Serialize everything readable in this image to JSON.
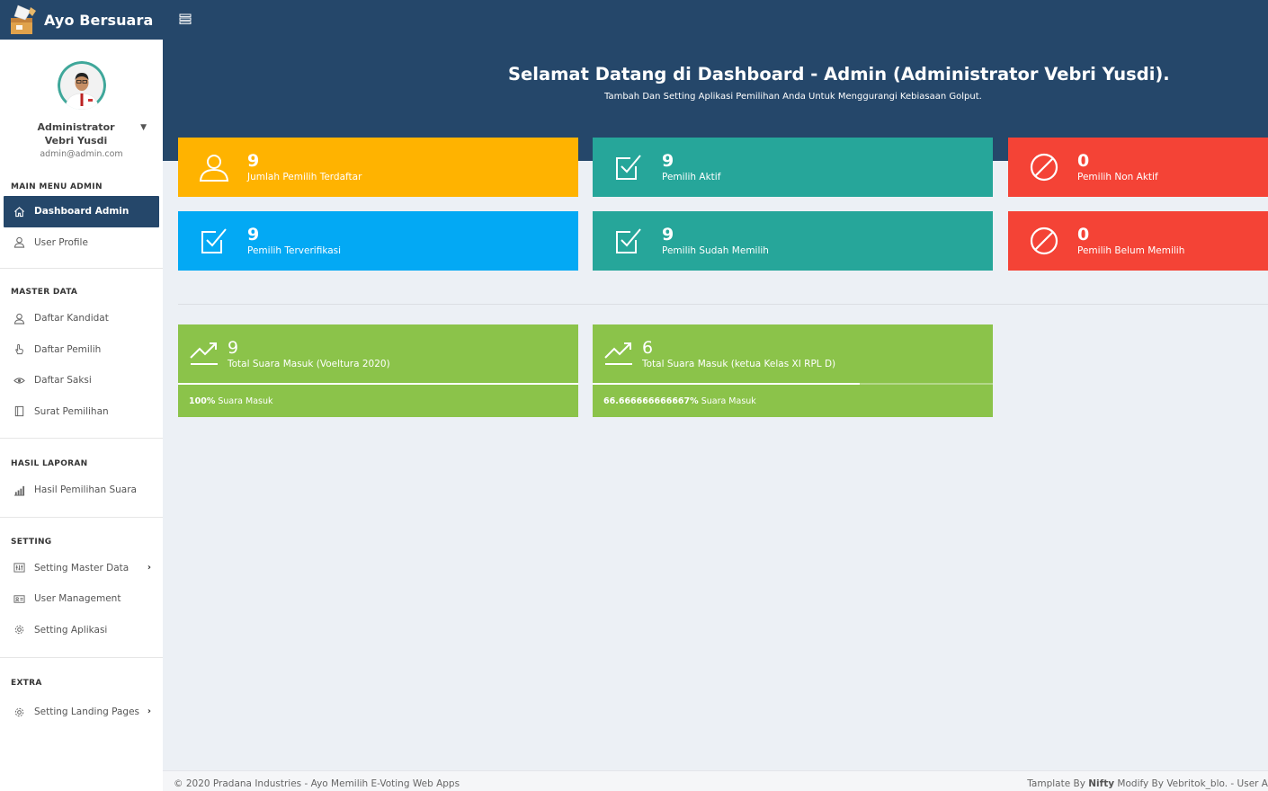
{
  "app": {
    "title": "Ayo Bersuara",
    "brand_color": "#25476a"
  },
  "header": {
    "welcome_title": "Selamat Datang di Dashboard - Admin (Administrator Vebri Yusdi).",
    "welcome_subtitle": "Tambah Dan Setting Aplikasi Pemilihan Anda Untuk Menggurangi Kebiasaan Golput."
  },
  "profile": {
    "name": "Administrator Vebri Yusdi",
    "email": "admin@admin.com"
  },
  "sidebar": {
    "sections": [
      {
        "title": "MAIN MENU ADMIN",
        "items": [
          {
            "label": "Dashboard Admin",
            "icon": "home-icon",
            "active": true
          },
          {
            "label": "User Profile",
            "icon": "user-icon"
          }
        ]
      },
      {
        "title": "MASTER DATA",
        "items": [
          {
            "label": "Daftar Kandidat",
            "icon": "user-icon"
          },
          {
            "label": "Daftar Pemilih",
            "icon": "hand-pointer-icon"
          },
          {
            "label": "Daftar Saksi",
            "icon": "eye-icon"
          },
          {
            "label": "Surat Pemilihan",
            "icon": "ballot-icon"
          }
        ]
      },
      {
        "title": "HASIL LAPORAN",
        "items": [
          {
            "label": "Hasil Pemilihan Suara",
            "icon": "bar-chart-icon"
          }
        ]
      },
      {
        "title": "SETTING",
        "items": [
          {
            "label": "Setting Master Data",
            "icon": "sliders-icon",
            "has_submenu": true
          },
          {
            "label": "User Management",
            "icon": "id-card-icon"
          },
          {
            "label": "Setting Aplikasi",
            "icon": "gear-icon"
          }
        ]
      },
      {
        "title": "EXTRA",
        "items": [
          {
            "label": "Setting Landing Pages",
            "icon": "gear-icon",
            "has_submenu": true
          }
        ]
      }
    ]
  },
  "stats": [
    {
      "value": "9",
      "label": "Jumlah Pemilih Terdaftar",
      "color": "#ffb300",
      "icon": "user-icon"
    },
    {
      "value": "9",
      "label": "Pemilih Aktif",
      "color": "#26a69a",
      "icon": "check-box-icon"
    },
    {
      "value": "0",
      "label": "Pemilih Non Aktif",
      "color": "#f44336",
      "icon": "ban-icon"
    },
    {
      "value": "9",
      "label": "Pemilih Terverifikasi",
      "color": "#03a9f4",
      "icon": "check-box-icon"
    },
    {
      "value": "9",
      "label": "Pemilih Sudah Memilih",
      "color": "#26a69a",
      "icon": "check-box-icon"
    },
    {
      "value": "0",
      "label": "Pemilih Belum Memilih",
      "color": "#f44336",
      "icon": "ban-icon"
    }
  ],
  "votes": [
    {
      "value": "9",
      "label": "Total Suara Masuk (Voeltura 2020)",
      "percent_text": "100%",
      "percent_suffix": " Suara Masuk",
      "progress": 1.0,
      "color": "#8bc34a",
      "icon": "trending-up-icon"
    },
    {
      "value": "6",
      "label": "Total Suara Masuk (ketua Kelas XI RPL D)",
      "percent_text": "66.666666666667%",
      "percent_suffix": " Suara Masuk",
      "progress": 0.6667,
      "color": "#8bc34a",
      "icon": "trending-up-icon"
    }
  ],
  "footer": {
    "left": "© 2020 Pradana Industries - Ayo Memilih E-Voting Web Apps",
    "right_prefix": "Tamplate By ",
    "right_bold": "Nifty",
    "right_suffix": " Modify By Vebritok_blo. - User A"
  }
}
